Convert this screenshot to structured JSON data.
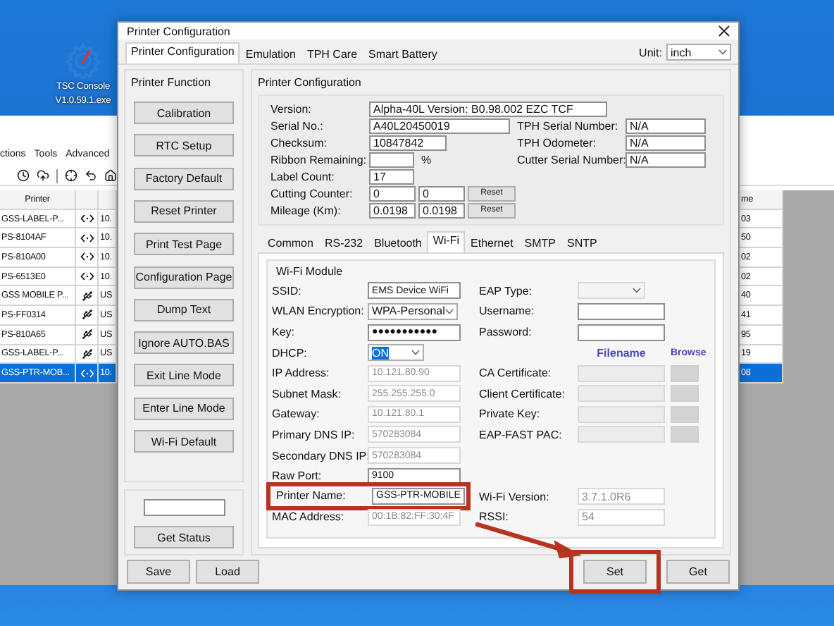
{
  "desktop_icon": {
    "label_lines": [
      "TSC Console",
      "V1.0.59.1.exe"
    ]
  },
  "background_app": {
    "menu": [
      "ctions",
      "Tools",
      "Advanced"
    ],
    "table": {
      "header_printer": "Printer",
      "header_tail": "me",
      "rows": [
        {
          "printer": "GSS-LABEL-P...",
          "kind": "network",
          "address": "10.",
          "tail": "03",
          "selected": false
        },
        {
          "printer": "PS-8104AF",
          "kind": "network",
          "address": "10.",
          "tail": "50",
          "selected": false
        },
        {
          "printer": "PS-810A00",
          "kind": "network",
          "address": "10.",
          "tail": "02",
          "selected": false
        },
        {
          "printer": "PS-6513E0",
          "kind": "network",
          "address": "10.",
          "tail": "02",
          "selected": false
        },
        {
          "printer": "GSS MOBILE P...",
          "kind": "usb",
          "address": "US",
          "tail": "40",
          "selected": false
        },
        {
          "printer": "PS-FF0314",
          "kind": "usb",
          "address": "US",
          "tail": "41",
          "selected": false
        },
        {
          "printer": "PS-810A65",
          "kind": "usb",
          "address": "US",
          "tail": "95",
          "selected": false
        },
        {
          "printer": "GSS-LABEL-P...",
          "kind": "usb",
          "address": "US",
          "tail": "19",
          "selected": false
        },
        {
          "printer": "GSS-PTR-MOB...",
          "kind": "network",
          "address": "10.",
          "tail": "08",
          "selected": true
        }
      ]
    }
  },
  "dialog": {
    "title": "Printer Configuration",
    "tabs": [
      {
        "label": "Printer Configuration",
        "selected": true
      },
      {
        "label": "Emulation",
        "selected": false
      },
      {
        "label": "TPH Care",
        "selected": false
      },
      {
        "label": "Smart Battery",
        "selected": false
      }
    ],
    "unit": {
      "label": "Unit:",
      "value": "inch"
    },
    "function_group": {
      "title": "Printer Function",
      "buttons": [
        "Calibration",
        "RTC Setup",
        "Factory Default",
        "Reset Printer",
        "Print Test Page",
        "Configuration Page",
        "Dump Text",
        "Ignore AUTO.BAS",
        "Exit Line Mode",
        "Enter Line Mode",
        "Wi-Fi Default"
      ],
      "status_button": "Get Status"
    },
    "config_group": {
      "title": "Printer Configuration",
      "info": [
        {
          "kind": "wide",
          "label": "Version:",
          "value": "Alpha-40L Version: B0.98.002 EZC TCF"
        },
        {
          "kind": "medium",
          "label": "Serial No.:",
          "value": "A40L20450019"
        },
        {
          "kind": "short",
          "label": "Checksum:",
          "value": "10847842"
        },
        {
          "kind": "percent",
          "label": "Ribbon Remaining:",
          "unit": "%"
        },
        {
          "kind": "narrow",
          "label": "Label Count:",
          "value": "17"
        },
        {
          "kind": "counter",
          "label": "Cutting Counter:",
          "values": [
            "0",
            "0"
          ],
          "button": "Reset"
        },
        {
          "kind": "counter",
          "label": "Mileage (Km):",
          "values": [
            "0.0198",
            "0.0198"
          ],
          "button": "Reset"
        }
      ],
      "tph": [
        {
          "label": "TPH Serial Number:",
          "value": "N/A"
        },
        {
          "label": "TPH Odometer:",
          "value": "N/A"
        },
        {
          "label": "Cutter Serial Number:",
          "value": "N/A"
        }
      ],
      "subtabs": [
        {
          "label": "Common",
          "selected": false
        },
        {
          "label": "RS-232",
          "selected": false
        },
        {
          "label": "Bluetooth",
          "selected": false
        },
        {
          "label": "Wi-Fi",
          "selected": true
        },
        {
          "label": "Ethernet",
          "selected": false
        },
        {
          "label": "SMTP",
          "selected": false
        },
        {
          "label": "SNTP",
          "selected": false
        }
      ],
      "wifi": {
        "title": "Wi-Fi Module",
        "left": [
          {
            "kind": "text",
            "label": "SSID:",
            "value": "EMS Device WiFi",
            "disabled": false,
            "focused": false,
            "highlighted": false
          },
          {
            "kind": "select",
            "label": "WLAN Encryption:",
            "value": "WPA-Personal",
            "disabled": false,
            "focused": false,
            "highlighted": false
          },
          {
            "kind": "text",
            "label": "Key:",
            "value": "●●●●●●●●●●●",
            "disabled": false,
            "focused": false,
            "highlighted": false
          },
          {
            "kind": "select",
            "label": "DHCP:",
            "value": "ON",
            "disabled": false,
            "focused": true,
            "highlighted": false
          },
          {
            "kind": "text",
            "label": "IP Address:",
            "value": "10.121.80.90",
            "disabled": true,
            "focused": false,
            "highlighted": false
          },
          {
            "kind": "text",
            "label": "Subnet Mask:",
            "value": "255.255.255.0",
            "disabled": true,
            "focused": false,
            "highlighted": false
          },
          {
            "kind": "text",
            "label": "Gateway:",
            "value": "10.121.80.1",
            "disabled": true,
            "focused": false,
            "highlighted": false
          },
          {
            "kind": "text",
            "label": "Primary DNS IP:",
            "value": "570283084",
            "disabled": true,
            "focused": false,
            "highlighted": false
          },
          {
            "kind": "text",
            "label": "Secondary DNS IP:",
            "value": "570283084",
            "disabled": true,
            "focused": false,
            "highlighted": false
          },
          {
            "kind": "text",
            "label": "Raw Port:",
            "value": "9100",
            "disabled": false,
            "focused": false,
            "highlighted": false
          },
          {
            "kind": "text",
            "label": "Printer Name:",
            "value": "GSS-PTR-MOBILE",
            "disabled": false,
            "focused": false,
            "highlighted": true
          },
          {
            "kind": "text",
            "label": "MAC Address:",
            "value": "00:1B:82:FF:30:4F",
            "disabled": true,
            "focused": false,
            "highlighted": false
          }
        ],
        "right": [
          {
            "kind": "select",
            "label": "EAP Type:",
            "disabled": true
          },
          {
            "kind": "text",
            "label": "Username:",
            "disabled": false
          },
          {
            "kind": "text",
            "label": "Password:",
            "disabled": false
          },
          {
            "kind": "header",
            "filename": "Filename",
            "browse": "Browse"
          },
          {
            "kind": "file",
            "label": "CA Certificate:",
            "disabled": true
          },
          {
            "kind": "file",
            "label": "Client Certificate:",
            "disabled": true
          },
          {
            "kind": "file",
            "label": "Private Key:",
            "disabled": true
          },
          {
            "kind": "file",
            "label": "EAP-FAST PAC:",
            "disabled": true
          },
          {
            "kind": "readout",
            "label": "Wi-Fi Version:",
            "value": "3.7.1.0R6",
            "disabled": true
          },
          {
            "kind": "readout",
            "label": "RSSI:",
            "value": "54",
            "disabled": true
          }
        ]
      }
    },
    "footer": {
      "left": [
        "Save",
        "Load"
      ],
      "right": [
        {
          "label": "Set",
          "highlighted": true
        },
        {
          "label": "Get",
          "highlighted": false
        }
      ]
    }
  }
}
